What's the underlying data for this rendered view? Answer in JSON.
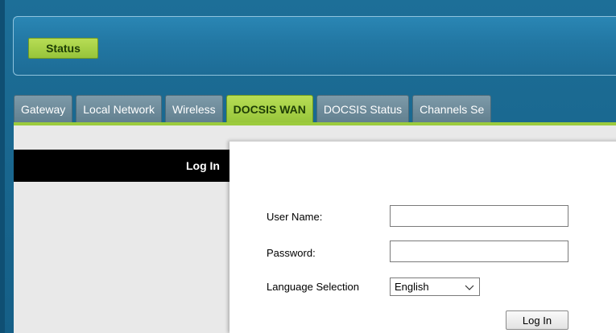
{
  "header": {
    "status_button": "Status"
  },
  "tabs": [
    {
      "label": "Gateway"
    },
    {
      "label": "Local Network"
    },
    {
      "label": "Wireless"
    },
    {
      "label": "DOCSIS WAN"
    },
    {
      "label": "DOCSIS Status"
    },
    {
      "label": "Channels Se"
    }
  ],
  "active_tab": "DOCSIS WAN",
  "sidebar": {
    "title": "Log In"
  },
  "login_form": {
    "username_label": "User Name:",
    "username_value": "",
    "password_label": "Password:",
    "password_value": "",
    "language_label": "Language Selection",
    "language_selected": "English",
    "submit_label": "Log In"
  },
  "colors": {
    "accent_green": "#9ccb3d",
    "background_blue": "#1b6b94",
    "tab_gray": "#6f8e9d"
  }
}
